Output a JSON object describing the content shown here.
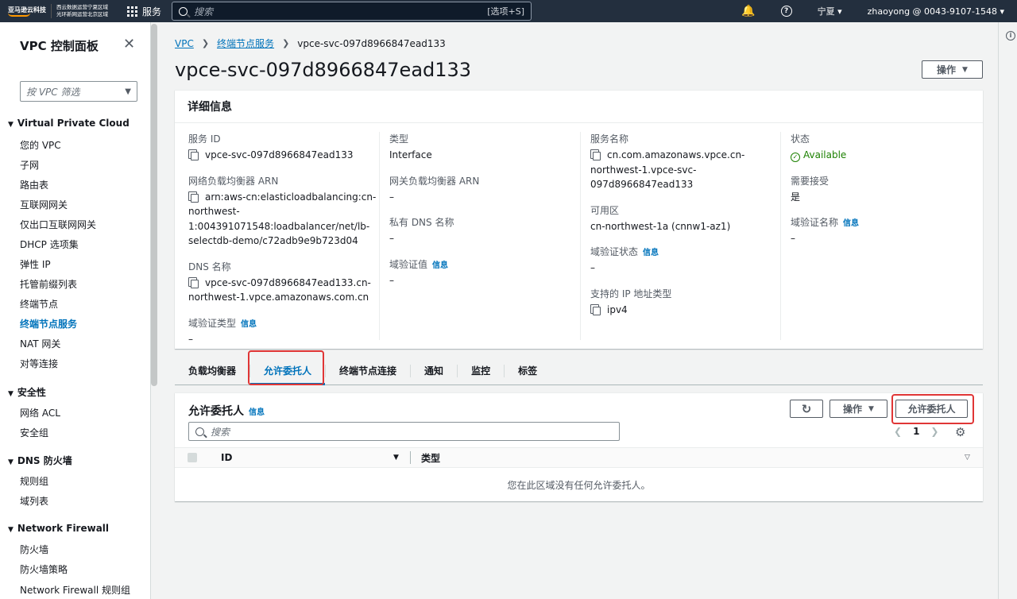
{
  "topnav": {
    "logo_text": "亚马逊云科技",
    "logo_sub1": "西云数据运营宁夏区域",
    "logo_sub2": "光环新网运营北京区域",
    "services_label": "服务",
    "search_placeholder": "搜索",
    "search_shortcut": "[选项+S]",
    "region": "宁夏",
    "account": "zhaoyong @ 0043-9107-1548"
  },
  "sidebar": {
    "title": "VPC 控制面板",
    "filter_placeholder": "按 VPC 筛选",
    "section_vpc": "Virtual Private Cloud",
    "vpc_items": [
      "您的 VPC",
      "子网",
      "路由表",
      "互联网网关",
      "仅出口互联网网关",
      "DHCP 选项集",
      "弹性 IP",
      "托管前缀列表",
      "终端节点",
      "终端节点服务",
      "NAT 网关",
      "对等连接"
    ],
    "section_security": "安全性",
    "security_items": [
      "网络 ACL",
      "安全组"
    ],
    "section_dns": "DNS 防火墙",
    "dns_items": [
      "规则组",
      "域列表"
    ],
    "section_nf": "Network Firewall",
    "nf_items": [
      "防火墙",
      "防火墙策略",
      "Network Firewall 规则组"
    ]
  },
  "breadcrumb": {
    "root": "VPC",
    "parent": "终端节点服务",
    "current": "vpce-svc-097d8966847ead133"
  },
  "page_title": "vpce-svc-097d8966847ead133",
  "actions_label": "操作",
  "details": {
    "header": "详细信息",
    "info": "信息",
    "service_id_label": "服务 ID",
    "service_id": "vpce-svc-097d8966847ead133",
    "nlb_arn_label": "网络负载均衡器 ARN",
    "nlb_arn_1": "arn:aws-cn:elasticloadbalancing:cn-",
    "nlb_arn_2": "northwest-",
    "nlb_arn_3": "1:004391071548:loadbalancer/net/lb-",
    "nlb_arn_4": "selectdb-demo/c72adb9e9b723d04",
    "dns_label": "DNS 名称",
    "dns_1": "vpce-svc-097d8966847ead133.cn-",
    "dns_2": "northwest-1.vpce.amazonaws.com.cn",
    "domain_type_label": "域验证类型",
    "domain_type": "–",
    "type_label": "类型",
    "type": "Interface",
    "gwlb_arn_label": "网关负载均衡器 ARN",
    "gwlb_arn": "–",
    "private_dns_label": "私有 DNS 名称",
    "private_dns": "–",
    "domain_value_label": "域验证值",
    "domain_value": "–",
    "service_name_label": "服务名称",
    "service_name_1": "cn.com.amazonaws.vpce.cn-",
    "service_name_2": "northwest-1.vpce-svc-",
    "service_name_3": "097d8966847ead133",
    "az_label": "可用区",
    "az": "cn-northwest-1a (cnnw1-az1)",
    "domain_status_label": "域验证状态",
    "domain_status": "–",
    "ip_type_label": "支持的 IP 地址类型",
    "ip_type": "ipv4",
    "state_label": "状态",
    "state": "Available",
    "accept_label": "需要接受",
    "accept": "是",
    "domain_name_label": "域验证名称",
    "domain_name": "–"
  },
  "tabs": [
    "负载均衡器",
    "允许委托人",
    "终端节点连接",
    "通知",
    "监控",
    "标签"
  ],
  "principals": {
    "title": "允许委托人",
    "info": "信息",
    "actions": "操作",
    "allow_button": "允许委托人",
    "search_placeholder": "搜索",
    "page": "1",
    "col_id": "ID",
    "col_type": "类型",
    "empty": "您在此区域没有任何允许委托人。"
  },
  "colors": {
    "accent": "#0073bb",
    "nav_bg": "#232f3e",
    "success": "#1d8102",
    "highlight": "#e03636"
  }
}
